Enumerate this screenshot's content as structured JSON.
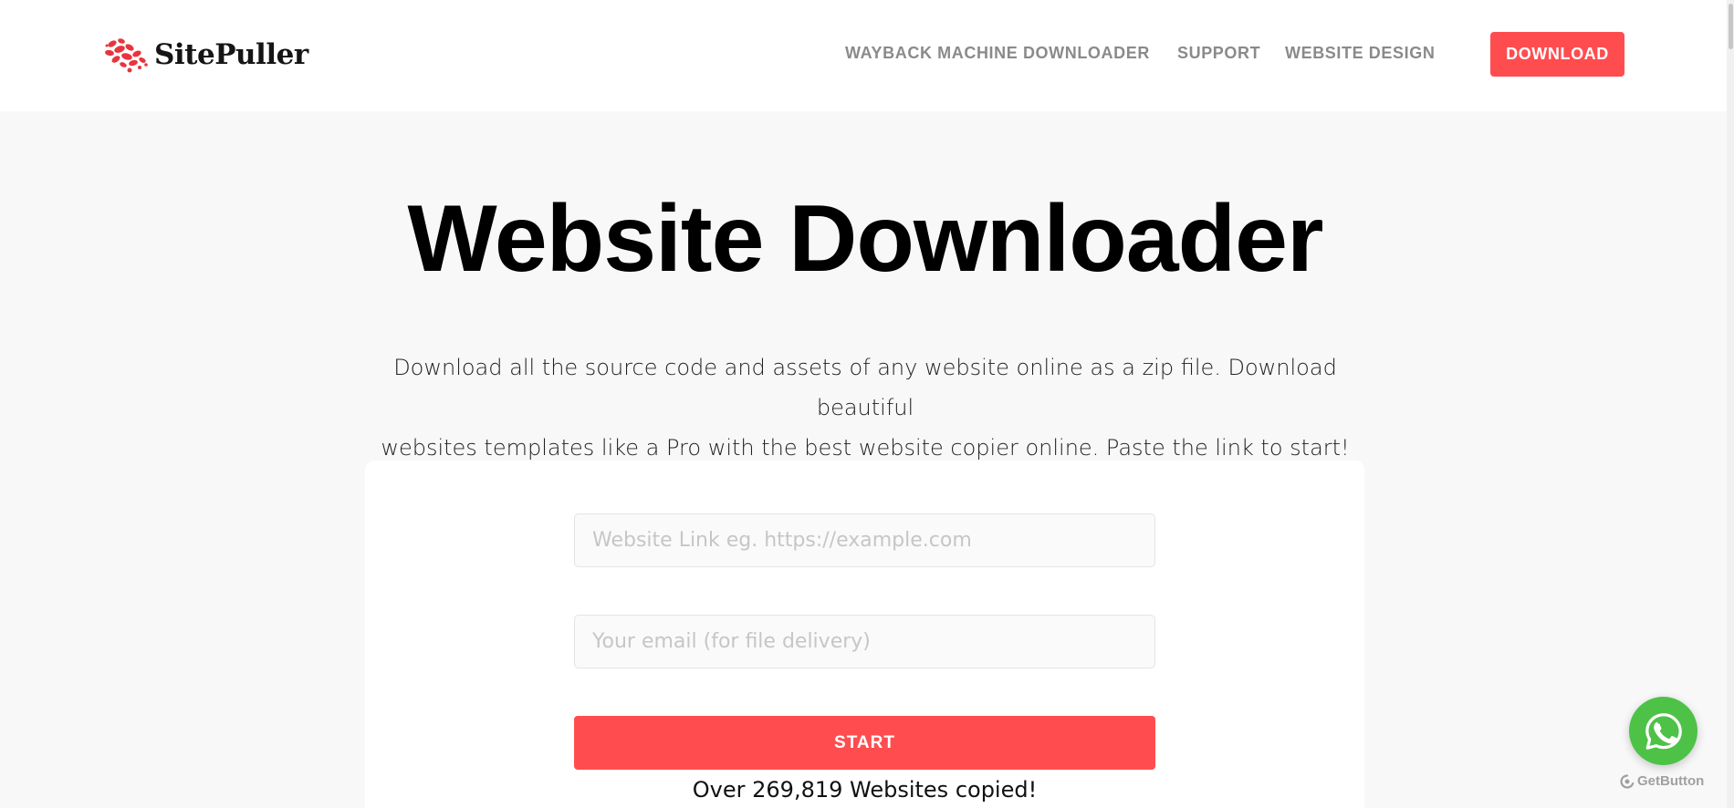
{
  "header": {
    "brand": "SitePuller",
    "brand_color": "#e8343d",
    "nav": {
      "wayback": "WAYBACK MACHINE DOWNLOADER",
      "support": "SUPPORT",
      "design": "WEBSITE DESIGN"
    },
    "download_label": "DOWNLOAD",
    "accent_color": "#ff4d4f"
  },
  "hero": {
    "title": "Website Downloader",
    "subtitle_line1": "Download all the source code and assets of any website online as a zip file. Download beautiful",
    "subtitle_line2": "websites templates like a Pro with the best website copier online. Paste the link to start!"
  },
  "form": {
    "url_placeholder": "Website Link eg. https://example.com",
    "email_placeholder": "Your email (for file delivery)",
    "url_value": "",
    "email_value": "",
    "start_label": "START",
    "counter_text": "Over 269,819 Websites copied!"
  },
  "widget": {
    "icon": "whatsapp-icon",
    "color": "#4dc247",
    "brand_label": "GetButton"
  }
}
